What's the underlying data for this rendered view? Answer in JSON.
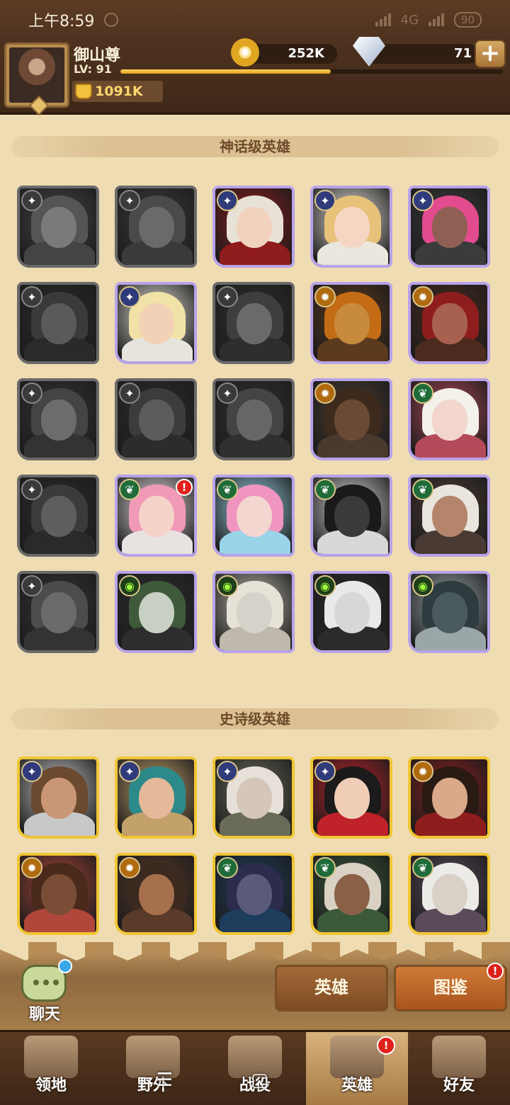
{
  "status_bar": {
    "time": "上午8:59",
    "network": "4G",
    "battery": "90"
  },
  "player": {
    "name": "御山尊",
    "level_label": "LV: 91",
    "xp_progress_percent": 55,
    "power": "1091K"
  },
  "currency": {
    "gold": "252K",
    "diamonds": "71",
    "add_label": "+"
  },
  "sections": {
    "mythic_title": "神话级英雄",
    "epic_title": "史诗级英雄"
  },
  "mythic_heroes": [
    {
      "faction": "none",
      "locked": true,
      "palette": [
        "#7a7a7a",
        "#555",
        "#444"
      ]
    },
    {
      "faction": "none",
      "locked": true,
      "palette": [
        "#6a6a6a",
        "#4a4a4a",
        "#3a3a3a"
      ]
    },
    {
      "faction": "lightbearer",
      "locked": false,
      "palette": [
        "#f1d2bf",
        "#e8e2d6",
        "#8e1c1c"
      ]
    },
    {
      "faction": "lightbearer",
      "locked": false,
      "palette": [
        "#f4d6c2",
        "#e9c27a",
        "#eae7df"
      ]
    },
    {
      "faction": "lightbearer",
      "locked": false,
      "palette": [
        "#8e5f52",
        "#e24b8d",
        "#3b3b3b"
      ]
    },
    {
      "faction": "none",
      "locked": true,
      "palette": [
        "#5a5a5a",
        "#3a3a3a",
        "#2a2a2a"
      ]
    },
    {
      "faction": "lightbearer",
      "locked": false,
      "palette": [
        "#f3d1b6",
        "#f1e3a8",
        "#e6e4dd"
      ]
    },
    {
      "faction": "none",
      "locked": true,
      "palette": [
        "#6a6a6a",
        "#3e3e3e",
        "#2e2e2e"
      ]
    },
    {
      "faction": "mauler",
      "locked": false,
      "palette": [
        "#c88a3c",
        "#c46b15",
        "#5c3a1d"
      ]
    },
    {
      "faction": "mauler",
      "locked": false,
      "palette": [
        "#a8614f",
        "#8e1e1e",
        "#4d2a1e"
      ]
    },
    {
      "faction": "none",
      "locked": true,
      "palette": [
        "#6c6c6c",
        "#444",
        "#333"
      ]
    },
    {
      "faction": "none",
      "locked": true,
      "palette": [
        "#5c5c5c",
        "#3c3c3c",
        "#2c2c2c"
      ]
    },
    {
      "faction": "none",
      "locked": true,
      "palette": [
        "#666",
        "#444",
        "#303030"
      ]
    },
    {
      "faction": "mauler",
      "locked": false,
      "palette": [
        "#6b4a35",
        "#3e2a1c",
        "#4a3a2e"
      ]
    },
    {
      "faction": "wilder",
      "locked": false,
      "palette": [
        "#f2d6ce",
        "#f4f0ea",
        "#b34a5a"
      ]
    },
    {
      "faction": "none",
      "locked": true,
      "palette": [
        "#5e5e5e",
        "#3b3b3b",
        "#2a2a2a"
      ]
    },
    {
      "faction": "wilder",
      "locked": false,
      "palette": [
        "#f6d3c9",
        "#f19ab8",
        "#e8e2e0"
      ],
      "alert": "!"
    },
    {
      "faction": "wilder",
      "locked": false,
      "palette": [
        "#f3d6d0",
        "#ef95bf",
        "#9ad4e8"
      ]
    },
    {
      "faction": "wilder",
      "locked": false,
      "palette": [
        "#3a3a3a",
        "#1a1a1a",
        "#d8d8d8"
      ]
    },
    {
      "faction": "wilder",
      "locked": false,
      "palette": [
        "#b4856b",
        "#e9e4dc",
        "#4a3a34"
      ]
    },
    {
      "faction": "none",
      "locked": true,
      "palette": [
        "#6a6a6a",
        "#4c4c4c",
        "#333"
      ]
    },
    {
      "faction": "graveborn",
      "locked": false,
      "palette": [
        "#c8cfc3",
        "#3f5a3a",
        "#2e2e2e"
      ]
    },
    {
      "faction": "graveborn",
      "locked": false,
      "palette": [
        "#d5d2c9",
        "#e6e2d8",
        "#bfb9ad"
      ]
    },
    {
      "faction": "graveborn",
      "locked": false,
      "palette": [
        "#d7d7d7",
        "#e9e9e9",
        "#2b2b2b"
      ]
    },
    {
      "faction": "graveborn",
      "locked": false,
      "palette": [
        "#4a5a5e",
        "#2e3c40",
        "#9aa6a8"
      ]
    }
  ],
  "epic_heroes": [
    {
      "faction": "lightbearer",
      "palette": [
        "#c99676",
        "#6b4a30",
        "#c8c8c8"
      ]
    },
    {
      "faction": "lightbearer",
      "palette": [
        "#e6b89a",
        "#2c8a8a",
        "#c3a16a"
      ]
    },
    {
      "faction": "lightbearer",
      "palette": [
        "#d4c6b8",
        "#e6e0d8",
        "#6b6b5a"
      ]
    },
    {
      "faction": "lightbearer",
      "palette": [
        "#f0cdb7",
        "#1b1b1b",
        "#c0222a"
      ]
    },
    {
      "faction": "mauler",
      "palette": [
        "#d9a989",
        "#2a1a14",
        "#8e1e1e"
      ]
    },
    {
      "faction": "mauler",
      "palette": [
        "#7a4e36",
        "#4a2a1a",
        "#b0473a"
      ]
    },
    {
      "faction": "mauler",
      "palette": [
        "#a6704c",
        "#3c2a20",
        "#5a3a28"
      ]
    },
    {
      "faction": "wilder",
      "palette": [
        "#5a5a7a",
        "#2c2c4c",
        "#1e3c5c"
      ]
    },
    {
      "faction": "wilder",
      "palette": [
        "#8a6046",
        "#d9d2c4",
        "#3a5a3a"
      ]
    },
    {
      "faction": "wilder",
      "palette": [
        "#d9d0c8",
        "#ecebe8",
        "#5a4a5a"
      ]
    }
  ],
  "faction_glyphs": {
    "none": "✦",
    "lightbearer": "✦",
    "mauler": "✹",
    "wilder": "❦",
    "graveborn": "◉"
  },
  "subtabs": {
    "heroes": "英雄",
    "codex": "图鉴",
    "codex_badge": "!"
  },
  "chat": {
    "label": "聊天"
  },
  "bottom_nav": [
    {
      "label": "领地",
      "icon": "castle-icon"
    },
    {
      "label": "野外",
      "icon": "map-scroll-icon"
    },
    {
      "label": "战役",
      "icon": "battle-shield-icon"
    },
    {
      "label": "英雄",
      "icon": "hero-helmet-icon",
      "badge": "!"
    },
    {
      "label": "好友",
      "icon": "friends-icon"
    }
  ],
  "system_nav": {
    "menu": "☰",
    "home": "▢",
    "back": "‹"
  },
  "colors": {
    "mythic_border": "#b8a2e8",
    "epic_border": "#f0c634",
    "parchment": "#efdcb3",
    "alert_red": "#e0211b"
  }
}
